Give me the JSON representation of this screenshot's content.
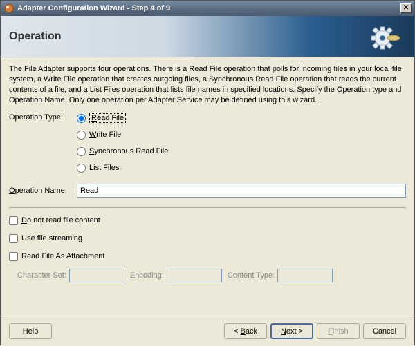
{
  "titlebar": {
    "title": "Adapter Configuration Wizard - Step 4 of 9"
  },
  "header": {
    "heading": "Operation"
  },
  "description": "The File Adapter supports four operations.  There is a Read File operation that polls for incoming files in your local file system, a Write File operation that creates outgoing files, a Synchronous Read File operation that reads the current contents of a file, and a List Files operation that lists file names in specified locations.  Specify the Operation type and Operation Name.  Only one operation per Adapter Service may be defined using this wizard.",
  "labels": {
    "operation_type": "Operation Type:",
    "operation_name": "Operation Name:"
  },
  "operation_types": {
    "read": "Read File",
    "write": "Write File",
    "sync": "Synchronous Read File",
    "list": "List Files"
  },
  "operation_name_value": "Read",
  "checkboxes": {
    "do_not_read": "Do not read file content",
    "streaming": "Use file streaming",
    "attachment": "Read File As Attachment"
  },
  "attach": {
    "charset": "Character Set:",
    "encoding": "Encoding:",
    "content_type": "Content Type:",
    "charset_val": "",
    "encoding_val": "",
    "content_type_val": ""
  },
  "buttons": {
    "help": "Help",
    "back": "< Back",
    "next": "Next >",
    "finish": "Finish",
    "cancel": "Cancel"
  }
}
